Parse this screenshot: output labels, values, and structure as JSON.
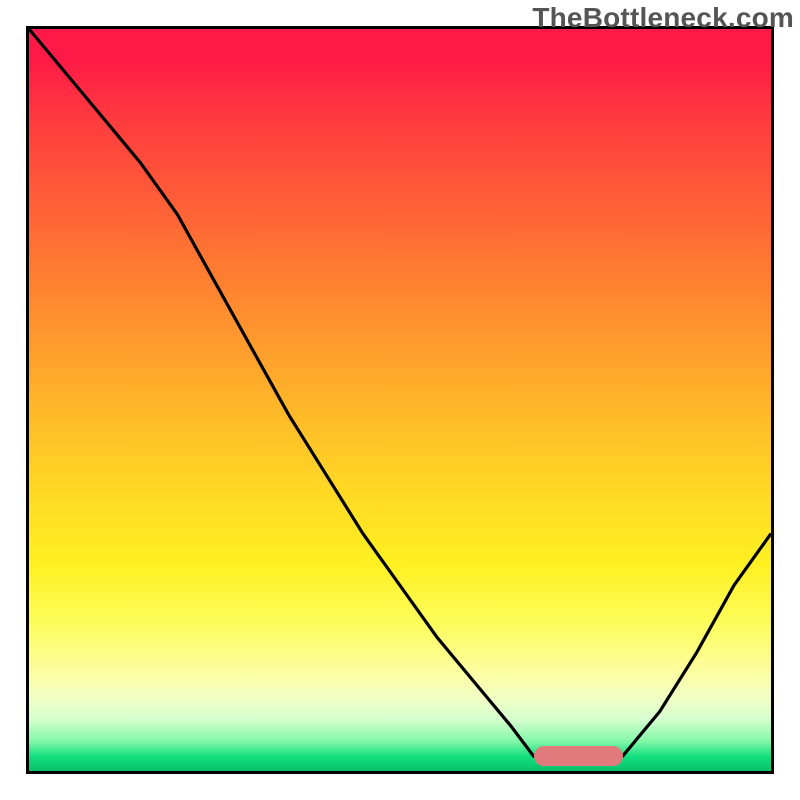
{
  "watermark": "TheBottleneck.com",
  "colors": {
    "border": "#000000",
    "curve": "#000000",
    "marker": "#e07a7c",
    "gradient_top": "#ff1a47",
    "gradient_bottom": "#0bc06b"
  },
  "chart_data": {
    "type": "line",
    "title": "",
    "xlabel": "",
    "ylabel": "",
    "xlim": [
      0,
      100
    ],
    "ylim": [
      0,
      100
    ],
    "grid": false,
    "legend": false,
    "annotations": [
      {
        "kind": "pill",
        "x_range": [
          68,
          80
        ],
        "y": 2,
        "color": "#e07a7c"
      }
    ],
    "series": [
      {
        "name": "bottleneck-curve",
        "x": [
          0,
          5,
          10,
          15,
          20,
          25,
          30,
          35,
          40,
          45,
          50,
          55,
          60,
          65,
          68,
          72,
          76,
          80,
          85,
          90,
          95,
          100
        ],
        "y": [
          100,
          94,
          88,
          82,
          75,
          66,
          57,
          48,
          40,
          32,
          25,
          18,
          12,
          6,
          2,
          1,
          1,
          2,
          8,
          16,
          25,
          32
        ]
      }
    ],
    "background": {
      "type": "vertical-gradient",
      "stops": [
        {
          "pct": 0,
          "color": "#ff1a47"
        },
        {
          "pct": 50,
          "color": "#ffc225"
        },
        {
          "pct": 80,
          "color": "#fff94d"
        },
        {
          "pct": 95,
          "color": "#9bf5af"
        },
        {
          "pct": 100,
          "color": "#0bc06b"
        }
      ]
    }
  }
}
